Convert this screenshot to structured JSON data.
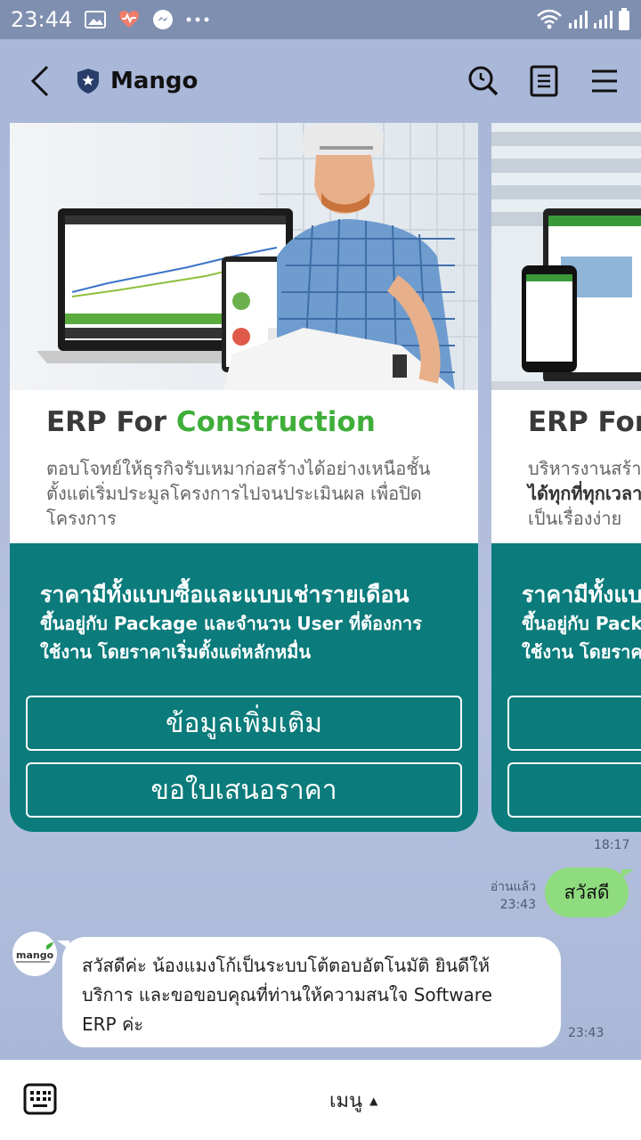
{
  "status_bar": {
    "time": "23:44",
    "icons": [
      "gallery-icon",
      "heart-pulse-icon",
      "messenger-icon",
      "more-icon",
      "wifi-icon",
      "signal-icon",
      "signal-icon",
      "battery-icon"
    ]
  },
  "header": {
    "title": "Mango",
    "icons": [
      "back-icon",
      "shield-star-icon",
      "search-icon",
      "notes-icon",
      "menu-icon"
    ]
  },
  "cards": [
    {
      "title_prefix": "ERP For ",
      "title_accent": "Construction",
      "desc_lines": [
        "ตอบโจทย์ให้ธุรกิจรับเหมาก่อสร้างได้อย่างเหนือชั้น",
        "ตั้งแต่เริ่มประมูลโครงการไปจนประเมินผล เพื่อปิด",
        "โครงการ"
      ],
      "promo_heading": "ราคามีทั้งแบบซื้อและแบบเช่ารายเดือน",
      "promo_sub_1": "ขึ้นอยู่กับ Package และจำนวน User ที่ต้องการ",
      "promo_sub_2": "ใช้งาน โดยราคาเริ่มตั้งแต่หลักหมื่น",
      "button_1": "ข้อมูลเพิ่มเติม",
      "button_2": "ขอใบเสนอราคา"
    },
    {
      "title_prefix": "ERP For",
      "desc_line_1": "บริหารงานสร้าง",
      "desc_line_2_bold": "ได้ทุกที่ทุกเวลา",
      "desc_line_3": "เป็นเรื่องง่าย",
      "promo_heading": "ราคามีทั้งแบ",
      "promo_sub_1": "ขึ้นอยู่กับ Pack",
      "promo_sub_2": "ใช้งาน โดยราคา",
      "button_2": "ข"
    }
  ],
  "messages": {
    "card_time": "18:17",
    "outgoing_text": "สวัสดี",
    "read_label": "อ่านแล้ว",
    "outgoing_time": "23:43",
    "incoming_line_1": "สวัสดีค่ะ น้องแมงโก้เป็นระบบโต้ตอบอัตโนมัติ ยินดีให้",
    "incoming_line_2": "บริการ และขอขอบคุณที่ท่านให้ความสนใจ Software",
    "incoming_line_3": "ERP ค่ะ",
    "incoming_time": "23:43",
    "avatar_text": "mango"
  },
  "bottom_bar": {
    "menu_label": "เมนู",
    "menu_arrow": "▲"
  }
}
